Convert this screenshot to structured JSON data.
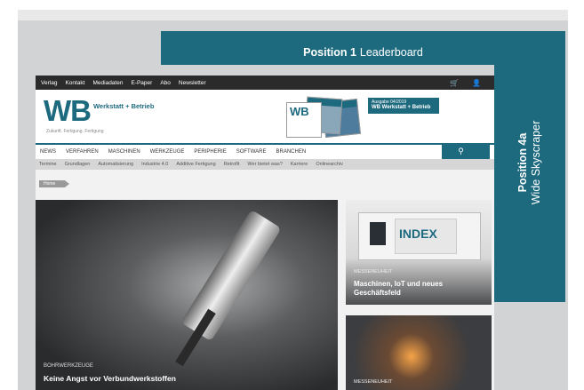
{
  "leaderboard": {
    "label_bold": "Position 1",
    "label": "Leaderboard"
  },
  "skyscraper": {
    "label_bold": "Position 4a",
    "label": "Wide Skyscraper"
  },
  "topbar": {
    "links": [
      "Verlag",
      "Kontakt",
      "Mediadaten",
      "E-Paper",
      "Abo",
      "Newsletter"
    ],
    "cart_icon": "cart-icon",
    "user_icon": "user-icon"
  },
  "logo": {
    "mark": "WB",
    "name": "Werkstatt + Betrieb",
    "tagline": "Zukunft. Fertigung. Fertigung"
  },
  "promo": {
    "line1": "Ausgabe 04/2019",
    "line2": "WB Werkstatt + Betrieb"
  },
  "magazine": {
    "cover_mark": "WB"
  },
  "nav": {
    "items": [
      "NEWS",
      "VERFAHREN",
      "MASCHINEN",
      "WERKZEUGE",
      "PERIPHERIE",
      "SOFTWARE",
      "BRANCHEN"
    ],
    "search_icon": "search-icon"
  },
  "subnav": {
    "items": [
      "Termine",
      "Grundlagen",
      "Automatisierung",
      "Industrie 4.0",
      "Additive Fertigung",
      "Retrofit",
      "Wer bietet was?",
      "Karriere",
      "Onlinearchiv"
    ]
  },
  "breadcrumb": {
    "home": "Home"
  },
  "hero": {
    "kicker": "BOHRWERKZEUGE",
    "title": "Keine Angst vor Verbundwerkstoffen"
  },
  "card1": {
    "kicker": "MESSENEUHEIT",
    "title": "Maschinen, IoT und neues Geschäftsfeld",
    "brand": "INDEX"
  },
  "card2": {
    "kicker": "MESSENEUHEIT"
  }
}
